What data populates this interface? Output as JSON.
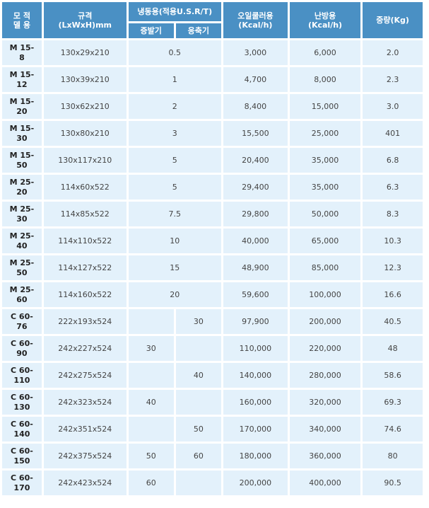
{
  "header": {
    "model": "모 적\n델 용",
    "spec": "규격\n(LxWxH)mm",
    "refrigeration": "냉동용(적용U.S.R/T)",
    "evaporator": "증발기",
    "condenser": "응축기",
    "oil_cooler": "오일쿨러용\n(Kcal/h)",
    "heating": "난방용\n(Kcal/h)",
    "weight": "중량(Kg)"
  },
  "rows": [
    {
      "model": "M 15-\n8",
      "size": "130x29x210",
      "merged": "0.5",
      "evap": "",
      "cond": "",
      "oil": "3,000",
      "heat": "6,000",
      "weight": "2.0"
    },
    {
      "model": "M 15-\n12",
      "size": "130x39x210",
      "merged": "1",
      "evap": "",
      "cond": "",
      "oil": "4,700",
      "heat": "8,000",
      "weight": "2.3"
    },
    {
      "model": "M 15-\n20",
      "size": "130x62x210",
      "merged": "2",
      "evap": "",
      "cond": "",
      "oil": "8,400",
      "heat": "15,000",
      "weight": "3.0"
    },
    {
      "model": "M 15-\n30",
      "size": "130x80x210",
      "merged": "3",
      "evap": "",
      "cond": "",
      "oil": "15,500",
      "heat": "25,000",
      "weight": "401"
    },
    {
      "model": "M 15-\n50",
      "size": "130x117x210",
      "merged": "5",
      "evap": "",
      "cond": "",
      "oil": "20,400",
      "heat": "35,000",
      "weight": "6.8"
    },
    {
      "model": "M 25-\n20",
      "size": "114x60x522",
      "merged": "5",
      "evap": "",
      "cond": "",
      "oil": "29,400",
      "heat": "35,000",
      "weight": "6.3"
    },
    {
      "model": "M 25-\n30",
      "size": "114x85x522",
      "merged": "7.5",
      "evap": "",
      "cond": "",
      "oil": "29,800",
      "heat": "50,000",
      "weight": "8.3"
    },
    {
      "model": "M 25-\n40",
      "size": "114x110x522",
      "merged": "10",
      "evap": "",
      "cond": "",
      "oil": "40,000",
      "heat": "65,000",
      "weight": "10.3"
    },
    {
      "model": "M 25-\n50",
      "size": "114x127x522",
      "merged": "15",
      "evap": "",
      "cond": "",
      "oil": "48,900",
      "heat": "85,000",
      "weight": "12.3"
    },
    {
      "model": "M 25-\n60",
      "size": "114x160x522",
      "merged": "20",
      "evap": "",
      "cond": "",
      "oil": "59,600",
      "heat": "100,000",
      "weight": "16.6"
    },
    {
      "model": "C 60-\n76",
      "size": "222x193x524",
      "merged": null,
      "evap": "",
      "cond": "30",
      "oil": "97,900",
      "heat": "200,000",
      "weight": "40.5"
    },
    {
      "model": "C 60-\n90",
      "size": "242x227x524",
      "merged": null,
      "evap": "30",
      "cond": "",
      "oil": "110,000",
      "heat": "220,000",
      "weight": "48"
    },
    {
      "model": "C 60-\n110",
      "size": "242x275x524",
      "merged": null,
      "evap": "",
      "cond": "40",
      "oil": "140,000",
      "heat": "280,000",
      "weight": "58.6"
    },
    {
      "model": "C 60-\n130",
      "size": "242x323x524",
      "merged": null,
      "evap": "40",
      "cond": "",
      "oil": "160,000",
      "heat": "320,000",
      "weight": "69.3"
    },
    {
      "model": "C 60-\n140",
      "size": "242x351x524",
      "merged": null,
      "evap": "",
      "cond": "50",
      "oil": "170,000",
      "heat": "340,000",
      "weight": "74.6"
    },
    {
      "model": "C 60-\n150",
      "size": "242x375x524",
      "merged": null,
      "evap": "50",
      "cond": "60",
      "oil": "180,000",
      "heat": "360,000",
      "weight": "80"
    },
    {
      "model": "C 60-\n170",
      "size": "242x423x524",
      "merged": null,
      "evap": "60",
      "cond": "",
      "oil": "200,000",
      "heat": "400,000",
      "weight": "90.5"
    }
  ],
  "colors": {
    "header_bg": "#4a90c4",
    "cell_bg": "#e3f1fb",
    "header_text": "#ffffff",
    "cell_text": "#444444"
  }
}
